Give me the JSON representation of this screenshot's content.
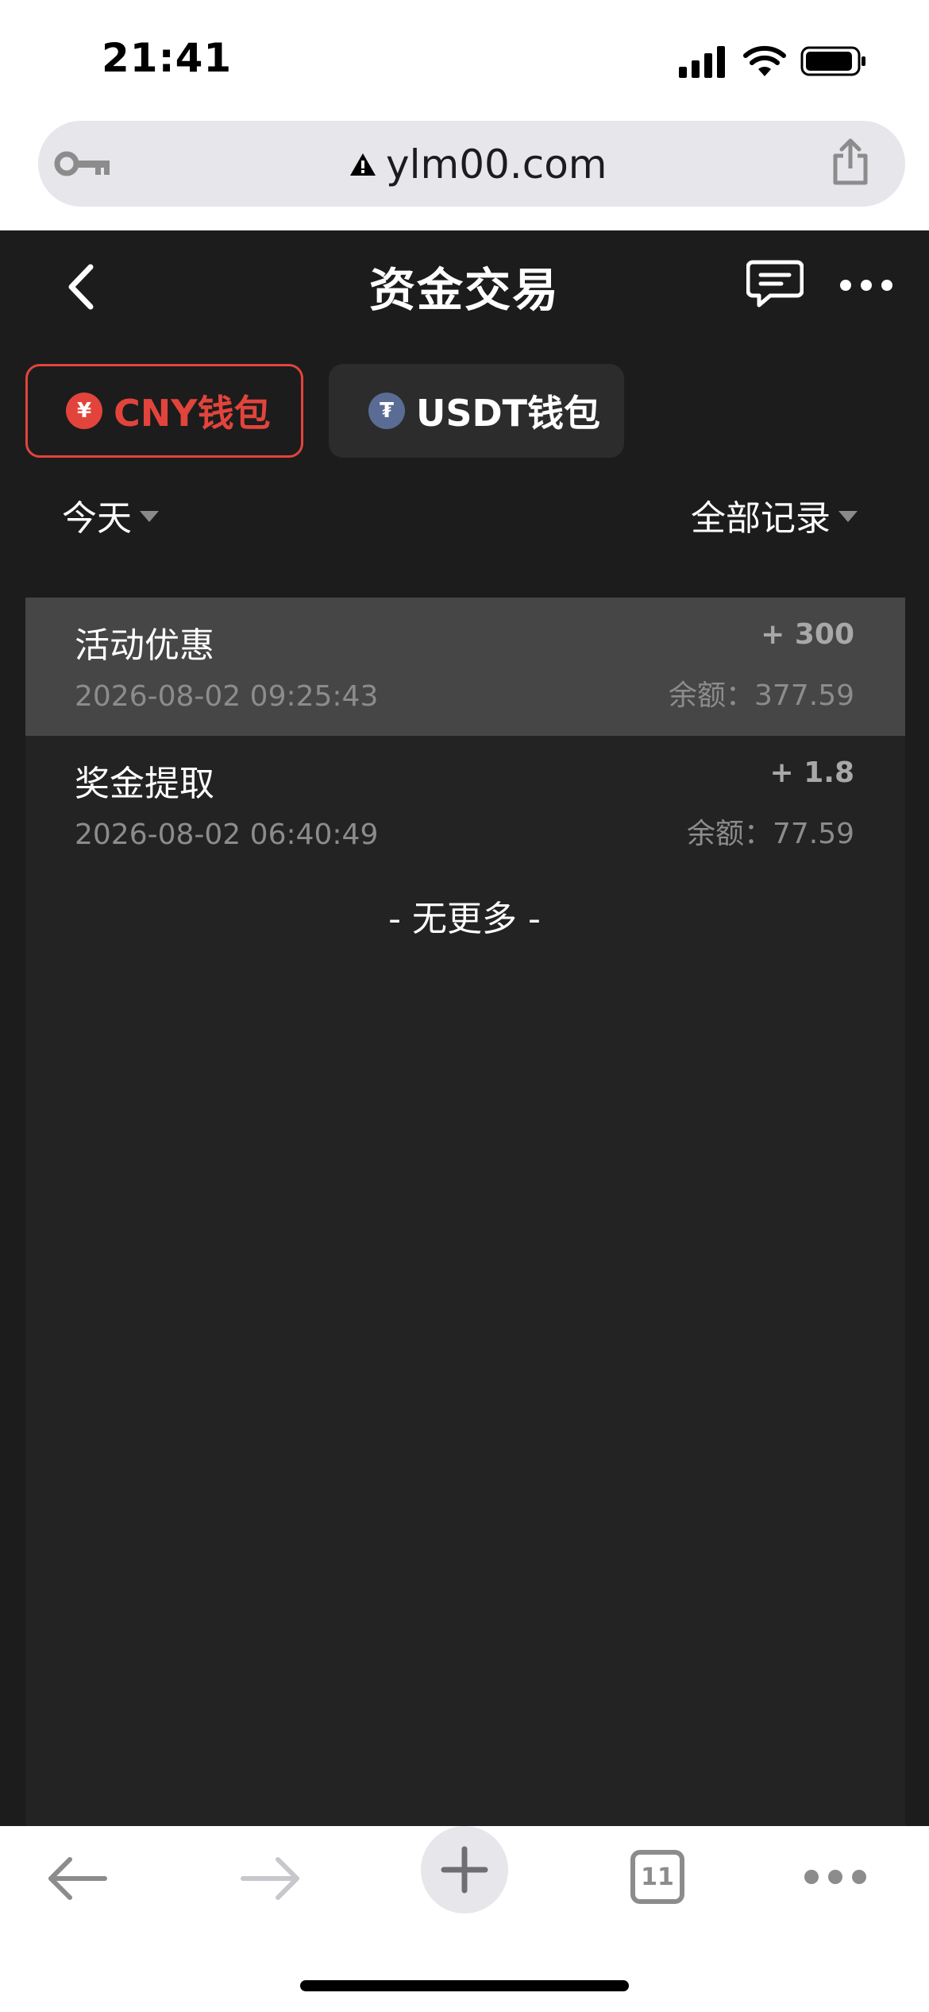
{
  "status_bar": {
    "time": "21:41"
  },
  "browser": {
    "url": "ylm00.com",
    "tab_count": "11"
  },
  "header": {
    "title": "资金交易"
  },
  "wallets": {
    "cny": {
      "label": "CNY钱包",
      "coin_symbol": "¥",
      "active": true
    },
    "usdt": {
      "label": "USDT钱包",
      "coin_symbol": "₮",
      "active": false
    }
  },
  "filters": {
    "date": "今天",
    "type": "全部记录"
  },
  "records": [
    {
      "title": "活动优惠",
      "time": "2026-08-02 09:25:43",
      "amount": "+ 300",
      "balance": "余额：377.59",
      "highlighted": true
    },
    {
      "title": "奖金提取",
      "time": "2026-08-02 06:40:49",
      "amount": "+ 1.8",
      "balance": "余额：77.59",
      "highlighted": false
    }
  ],
  "list_footer": "- 无更多 -",
  "colors": {
    "accent": "#e2443c",
    "background": "#1c1c1c",
    "panel": "#232323",
    "highlight_row": "#464646"
  },
  "icons": {
    "url_left": "key-icon",
    "url_warning": "warning-icon",
    "url_right": "share-icon",
    "header_left": "back-arrow-icon",
    "header_chat": "chat-bubble-icon",
    "header_more": "more-dots-icon",
    "toolbar": [
      "back-icon",
      "forward-icon",
      "plus-icon",
      "tabs-icon",
      "menu-dots-icon"
    ]
  }
}
